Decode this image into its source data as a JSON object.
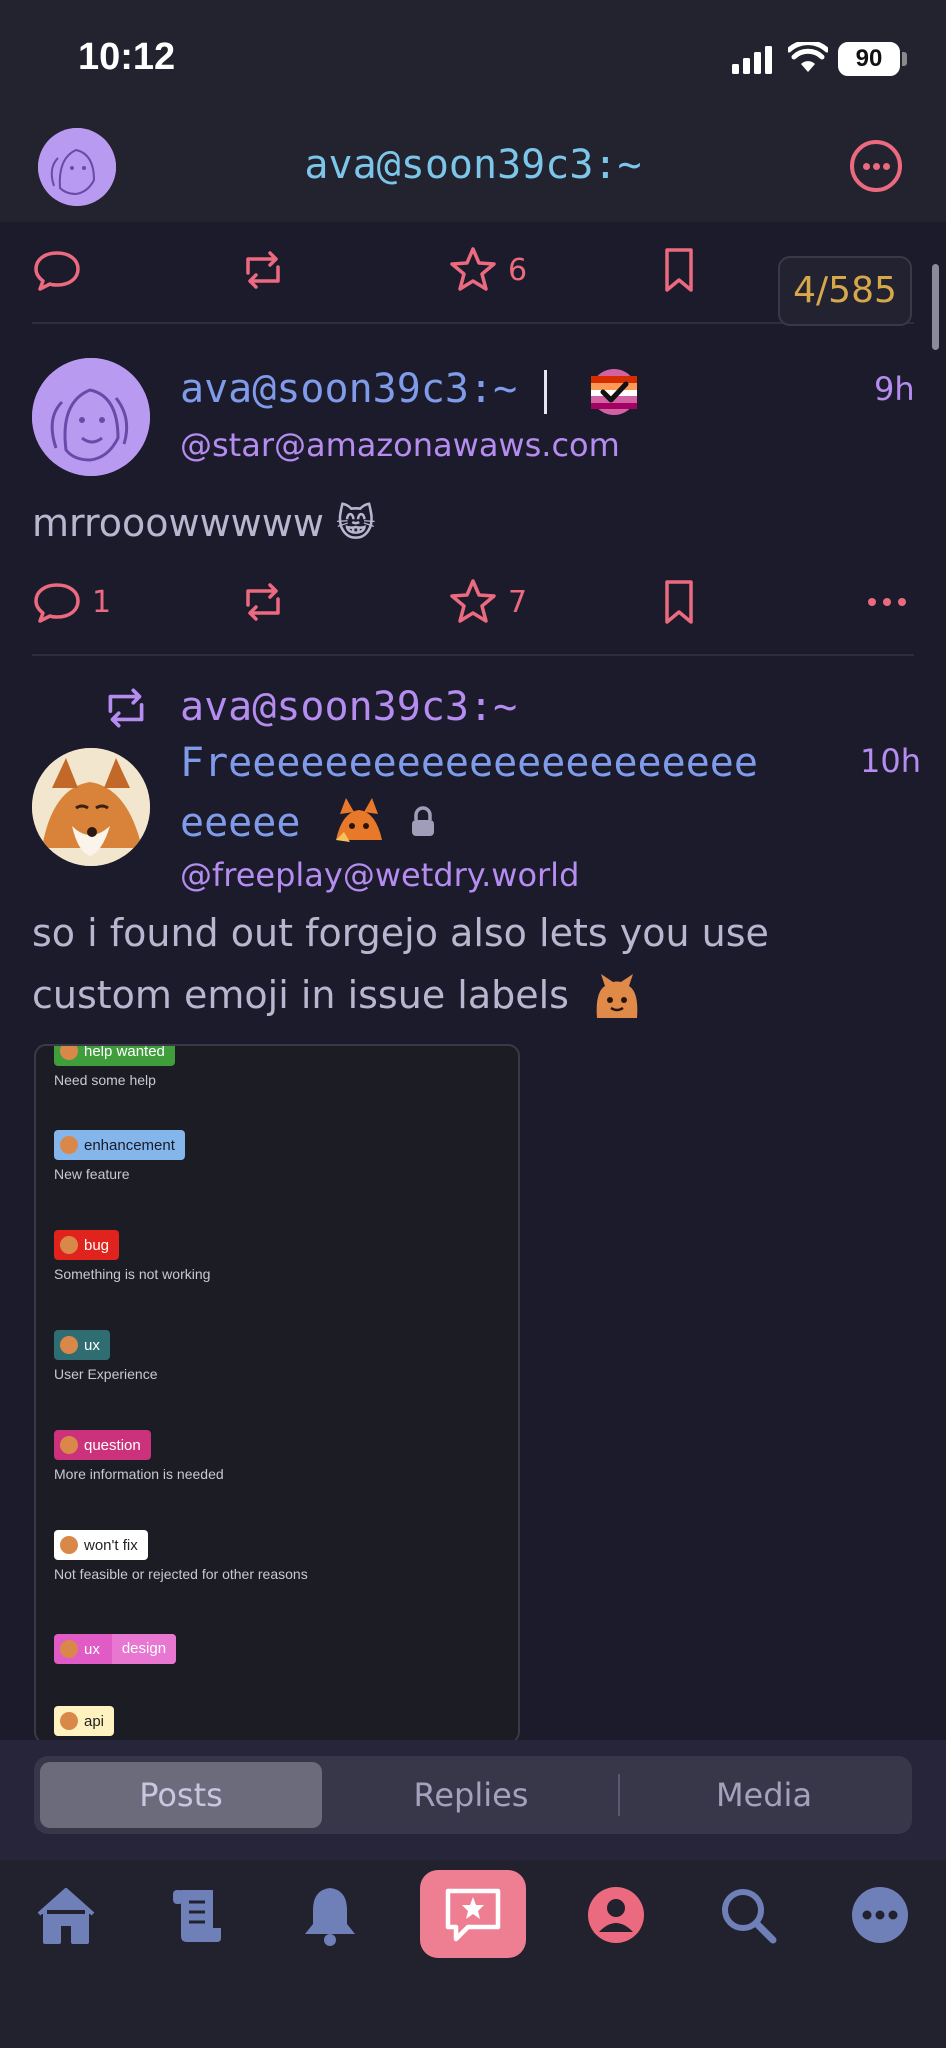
{
  "status_bar": {
    "time": "10:12",
    "battery": "90"
  },
  "header": {
    "title": "ava@soon39c3:~"
  },
  "top_actions": {
    "favorites_count": "6"
  },
  "counter": "4/585",
  "post1": {
    "display_name": "ava@soon39c3:~",
    "handle": "@star@amazonawaws.com",
    "time": "9h",
    "text": "mrrooowwwww 😸",
    "reply_count": "1",
    "favorite_count": "7"
  },
  "post2": {
    "boosted_by": "ava@soon39c3:~",
    "display_name_line1": "Freeeeeeeeeeeeeeeeeeeeee",
    "display_name_line2": "eeeee",
    "handle": "@freeplay@wetdry.world",
    "time": "10h",
    "text": "so i found out forgejo also lets you use custom emoji in issue labels",
    "labels": [
      {
        "name": "help wanted",
        "desc": "Need some help",
        "color": "#3f9e3b",
        "text_color": "#ffffff"
      },
      {
        "name": "enhancement",
        "desc": "New feature",
        "color": "#84b6eb",
        "text_color": "#1a1a2a"
      },
      {
        "name": "bug",
        "desc": "Something is not working",
        "color": "#ee0701",
        "text_color": "#ffffff"
      },
      {
        "name": "ux",
        "desc": "User Experience",
        "color": "#2f6d73",
        "text_color": "#ffffff"
      },
      {
        "name": "question",
        "desc": "More information is needed",
        "color": "#cc317c",
        "text_color": "#ffffff"
      },
      {
        "name": "won't fix",
        "desc": "Not feasible or rejected for other reasons",
        "color": "#ffffff",
        "text_color": "#222222"
      },
      {
        "name": "ux",
        "name2": "design",
        "desc": "",
        "color": "#e05bc6",
        "text_color": "#ffffff"
      },
      {
        "name": "api",
        "desc": "",
        "color": "#fef2c0",
        "text_color": "#222222"
      }
    ]
  },
  "tabs": [
    "Posts",
    "Replies",
    "Media"
  ],
  "colors": {
    "accent": "#ec6a80",
    "name": "#7f9bea",
    "handle": "#b58cf0",
    "background": "#1c1b2b"
  }
}
